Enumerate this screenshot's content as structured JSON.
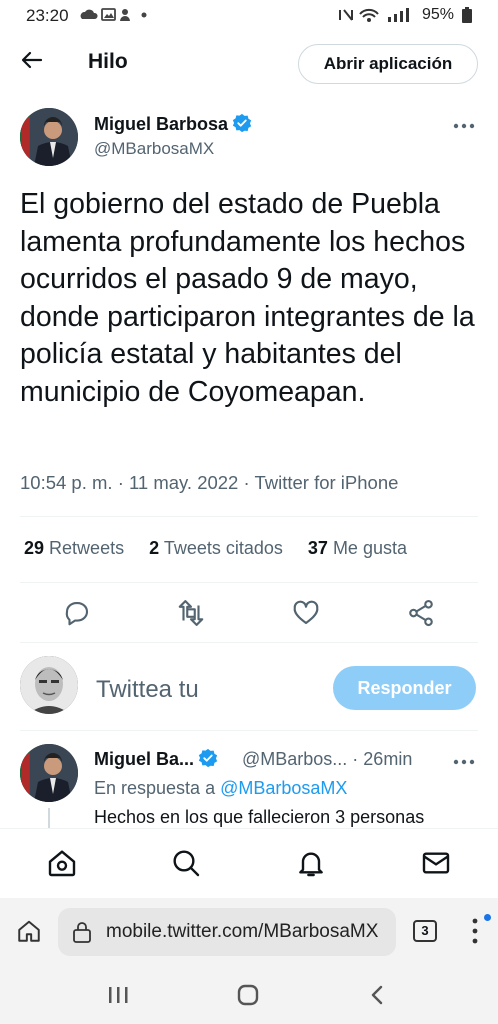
{
  "status_bar": {
    "time": "23:20",
    "battery": "95%"
  },
  "header": {
    "title": "Hilo",
    "open_app_label": "Abrir aplicación"
  },
  "tweet": {
    "author_name": "Miguel Barbosa",
    "author_handle": "@MBarbosaMX",
    "text": "El gobierno del estado de Puebla lamenta profundamente los hechos ocurridos el pasado 9 de mayo, donde participaron integrantes de la policía estatal y habitantes del municipio de Coyomeapan.",
    "timestamp": "10:54 p. m. · 11 may. 2022 · Twitter for iPhone",
    "retweets_count": "29",
    "retweets_label": "Retweets",
    "quotes_count": "2",
    "quotes_label": "Tweets citados",
    "likes_count": "37",
    "likes_label": "Me gusta"
  },
  "compose": {
    "placeholder": "Twittea tu",
    "reply_button": "Responder"
  },
  "reply": {
    "author_name": "Miguel Ba...",
    "author_handle_time": "@MBarbos... · 26min",
    "in_reply_prefix": "En respuesta a",
    "in_reply_handle": "@MBarbosaMX",
    "text": "Hechos en los que fallecieron 3 personas"
  },
  "browser": {
    "url": "mobile.twitter.com/MBarbosaMX",
    "tab_count": "3"
  },
  "colors": {
    "accent": "#1d9bf0",
    "reply_button_bg": "#8ecdf8",
    "secondary_text": "#536471"
  }
}
